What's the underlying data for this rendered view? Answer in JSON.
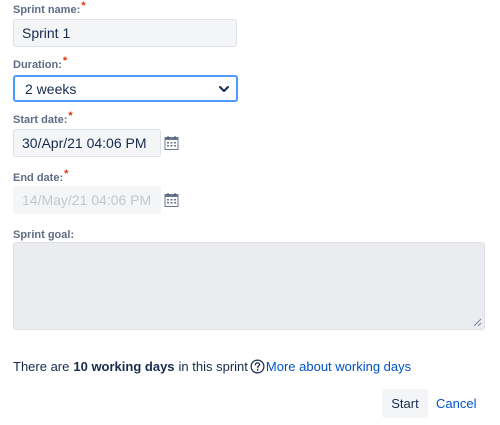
{
  "form": {
    "sprint_name": {
      "label": "Sprint name:",
      "required_mark": "*",
      "value": "Sprint 1"
    },
    "duration": {
      "label": "Duration:",
      "required_mark": "*",
      "selected": "2 weeks",
      "icon": "chevron-down-icon"
    },
    "start_date": {
      "label": "Start date:",
      "required_mark": "*",
      "value": "30/Apr/21 04:06 PM",
      "icon": "calendar-icon"
    },
    "end_date": {
      "label": "End date:",
      "required_mark": "*",
      "value": "14/May/21 04:06 PM",
      "icon": "calendar-icon"
    },
    "sprint_goal": {
      "label": "Sprint goal:",
      "value": ""
    }
  },
  "info": {
    "prefix": "There are",
    "bold": "10 working days",
    "suffix": "in this sprint",
    "help_icon": "question-circle-icon",
    "link": "More about working days"
  },
  "actions": {
    "start_label": "Start",
    "cancel_label": "Cancel"
  },
  "colors": {
    "link": "#0052cc",
    "required": "#de350b",
    "focus": "#4c9aff"
  }
}
